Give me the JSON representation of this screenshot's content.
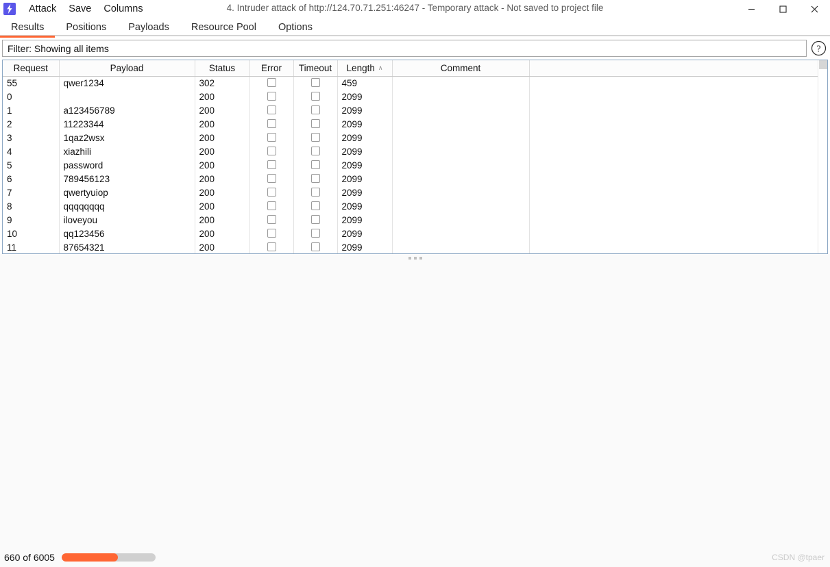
{
  "window": {
    "title": "4. Intruder attack of http://124.70.71.251:46247 - Temporary attack - Not saved to project file",
    "logo_icon": "burp-lightning-icon",
    "minimize_label": "—",
    "maximize_label": "□",
    "close_label": "✕"
  },
  "menu": {
    "items": [
      {
        "label": "Attack"
      },
      {
        "label": "Save"
      },
      {
        "label": "Columns"
      }
    ]
  },
  "tabs": {
    "active": "Results",
    "accent_color": "#ff6633",
    "items": [
      {
        "label": "Results",
        "active": true
      },
      {
        "label": "Positions",
        "active": false
      },
      {
        "label": "Payloads",
        "active": false
      },
      {
        "label": "Resource Pool",
        "active": false
      },
      {
        "label": "Options",
        "active": false
      }
    ]
  },
  "filter": {
    "text": "Filter: Showing all items",
    "help_icon": "question-mark-circle-icon"
  },
  "results_table": {
    "sort_column": "Length",
    "sort_direction": "ascending",
    "sort_caret": "∧",
    "columns": [
      {
        "key": "request",
        "label": "Request"
      },
      {
        "key": "payload",
        "label": "Payload"
      },
      {
        "key": "status",
        "label": "Status"
      },
      {
        "key": "error",
        "label": "Error"
      },
      {
        "key": "timeout",
        "label": "Timeout"
      },
      {
        "key": "length",
        "label": "Length"
      },
      {
        "key": "comment",
        "label": "Comment"
      }
    ],
    "rows": [
      {
        "request": "55",
        "payload": "qwer1234",
        "status": "302",
        "error": false,
        "timeout": false,
        "length": "459",
        "comment": ""
      },
      {
        "request": "0",
        "payload": "",
        "status": "200",
        "error": false,
        "timeout": false,
        "length": "2099",
        "comment": ""
      },
      {
        "request": "1",
        "payload": "a123456789",
        "status": "200",
        "error": false,
        "timeout": false,
        "length": "2099",
        "comment": ""
      },
      {
        "request": "2",
        "payload": "11223344",
        "status": "200",
        "error": false,
        "timeout": false,
        "length": "2099",
        "comment": ""
      },
      {
        "request": "3",
        "payload": "1qaz2wsx",
        "status": "200",
        "error": false,
        "timeout": false,
        "length": "2099",
        "comment": ""
      },
      {
        "request": "4",
        "payload": "xiazhili",
        "status": "200",
        "error": false,
        "timeout": false,
        "length": "2099",
        "comment": ""
      },
      {
        "request": "5",
        "payload": "password",
        "status": "200",
        "error": false,
        "timeout": false,
        "length": "2099",
        "comment": ""
      },
      {
        "request": "6",
        "payload": "789456123",
        "status": "200",
        "error": false,
        "timeout": false,
        "length": "2099",
        "comment": ""
      },
      {
        "request": "7",
        "payload": "qwertyuiop",
        "status": "200",
        "error": false,
        "timeout": false,
        "length": "2099",
        "comment": ""
      },
      {
        "request": "8",
        "payload": "qqqqqqqq",
        "status": "200",
        "error": false,
        "timeout": false,
        "length": "2099",
        "comment": ""
      },
      {
        "request": "9",
        "payload": "iloveyou",
        "status": "200",
        "error": false,
        "timeout": false,
        "length": "2099",
        "comment": ""
      },
      {
        "request": "10",
        "payload": "qq123456",
        "status": "200",
        "error": false,
        "timeout": false,
        "length": "2099",
        "comment": ""
      },
      {
        "request": "11",
        "payload": "87654321",
        "status": "200",
        "error": false,
        "timeout": false,
        "length": "2099",
        "comment": ""
      }
    ]
  },
  "status_bar": {
    "count_text": "660 of 6005",
    "progress_percent": 60,
    "progress_color": "#ff6633",
    "track_color": "#d0d0d0",
    "watermark": "CSDN @tpaer"
  }
}
